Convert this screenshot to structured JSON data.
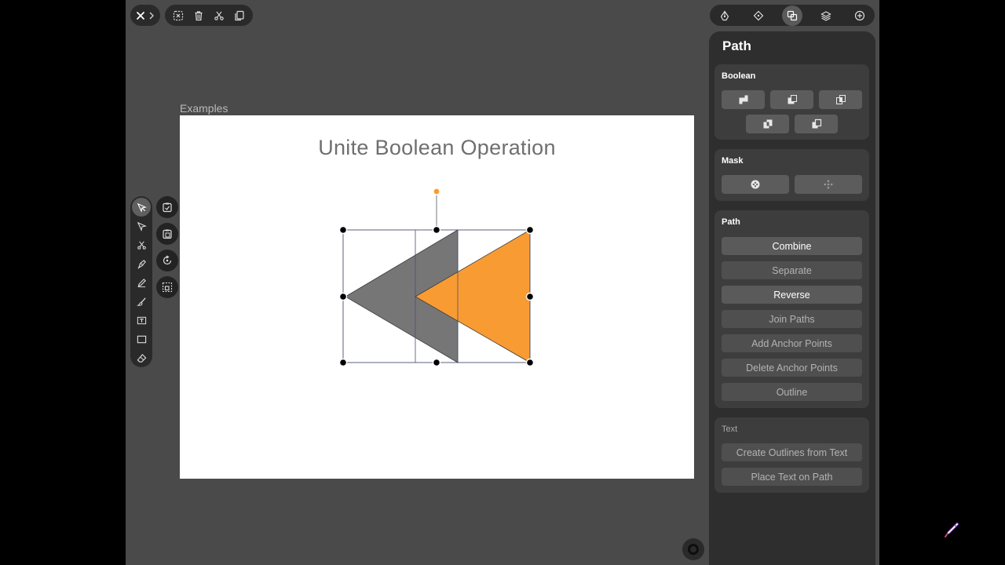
{
  "app": {
    "document_label": "Examples",
    "canvas_title": "Unite Boolean Operation"
  },
  "top_left": {
    "icons": [
      "close-icon",
      "chevron-right-icon"
    ]
  },
  "top_tools": {
    "icons": [
      "deselect-icon",
      "trash-icon",
      "scissors-icon",
      "duplicate-icon"
    ]
  },
  "top_right_tabs": {
    "icons": [
      "pen-nib-icon",
      "anchor-point-icon",
      "path-ops-icon",
      "layers-icon",
      "add-icon"
    ],
    "active": "path-ops-icon"
  },
  "left_tools": {
    "icons": [
      "select-arrow-icon",
      "direct-select-icon",
      "scissors-icon",
      "pen-tool-icon",
      "pencil-icon",
      "brush-icon",
      "text-tool-icon",
      "rectangle-icon",
      "eraser-icon"
    ],
    "active": "select-arrow-icon"
  },
  "side_actions": {
    "icons": [
      "paste-in-place-icon",
      "paste-icon",
      "rotate-icon",
      "transform-icon"
    ]
  },
  "panel": {
    "title": "Path",
    "boolean": {
      "title": "Boolean",
      "buttons": [
        "unite-icon",
        "subtract-front-icon",
        "intersect-icon",
        "exclude-icon",
        "divide-icon"
      ]
    },
    "mask": {
      "title": "Mask",
      "buttons": [
        "mask-icon",
        "release-mask-icon"
      ]
    },
    "path": {
      "title": "Path",
      "combine": "Combine",
      "separate": "Separate",
      "reverse": "Reverse",
      "join_paths": "Join Paths",
      "add_anchor_points": "Add Anchor Points",
      "delete_anchor_points": "Delete Anchor Points",
      "outline": "Outline"
    },
    "text": {
      "title": "Text",
      "create_outlines": "Create Outlines from Text",
      "place_on_path": "Place Text on Path"
    }
  },
  "colors": {
    "accent_orange": "#f99b33",
    "shape_gray": "#767677",
    "panel_bg": "#2e2e2e",
    "workspace_bg": "#4a4a4a"
  }
}
